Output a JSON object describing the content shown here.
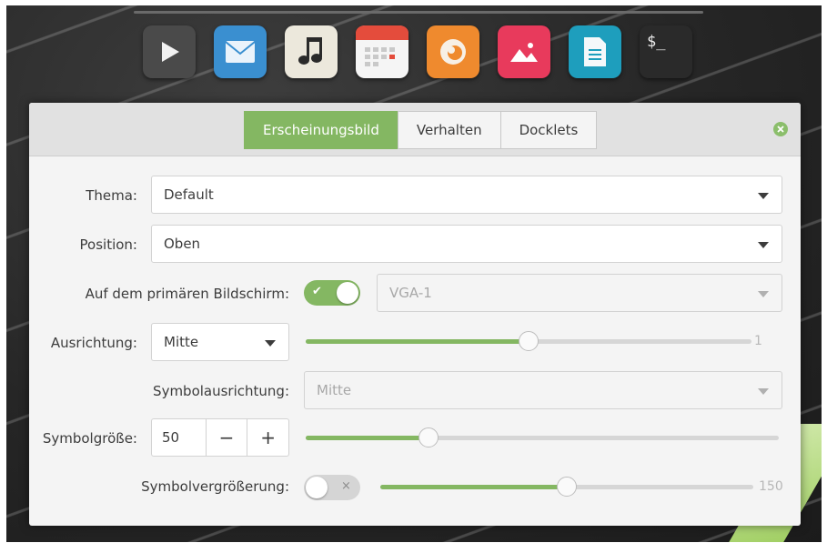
{
  "dock": {
    "icons": [
      {
        "name": "media-player-icon",
        "color": "#4a4a4a"
      },
      {
        "name": "mail-icon",
        "color": "#3a8fd0"
      },
      {
        "name": "music-icon",
        "color": "#ece8dc"
      },
      {
        "name": "calendar-icon",
        "color": "#e44c3c"
      },
      {
        "name": "firefox-icon",
        "color": "#ef8a2e"
      },
      {
        "name": "image-viewer-icon",
        "color": "#e83a5c"
      },
      {
        "name": "text-document-icon",
        "color": "#1e9ebd"
      },
      {
        "name": "terminal-icon",
        "color": "#2a2a2a",
        "text": "$_"
      }
    ]
  },
  "tabs": [
    {
      "label": "Erscheinungsbild",
      "active": true
    },
    {
      "label": "Verhalten",
      "active": false
    },
    {
      "label": "Docklets",
      "active": false
    }
  ],
  "settings": {
    "thema": {
      "label": "Thema:",
      "value": "Default"
    },
    "position": {
      "label": "Position:",
      "value": "Oben"
    },
    "primary_screen": {
      "label": "Auf dem primären Bildschirm:",
      "switch_on": true,
      "switch_mark": "✔",
      "monitor": "VGA-1"
    },
    "ausrichtung": {
      "label": "Ausrichtung:",
      "value": "Mitte",
      "slider_value": 0.5,
      "slider_end_label": "1"
    },
    "symbolausrichtung": {
      "label": "Symbolausrichtung:",
      "value": "Mitte"
    },
    "symbolgroesse": {
      "label": "Symbolgröße:",
      "value": "50",
      "minus": "−",
      "plus": "+",
      "slider_value": 0.26
    },
    "symbolvergroesserung": {
      "label": "Symbolvergrößerung:",
      "switch_on": false,
      "switch_mark": "×",
      "slider_value": 0.5,
      "slider_end_label": "150"
    }
  },
  "colors": {
    "accent": "#84b762"
  }
}
